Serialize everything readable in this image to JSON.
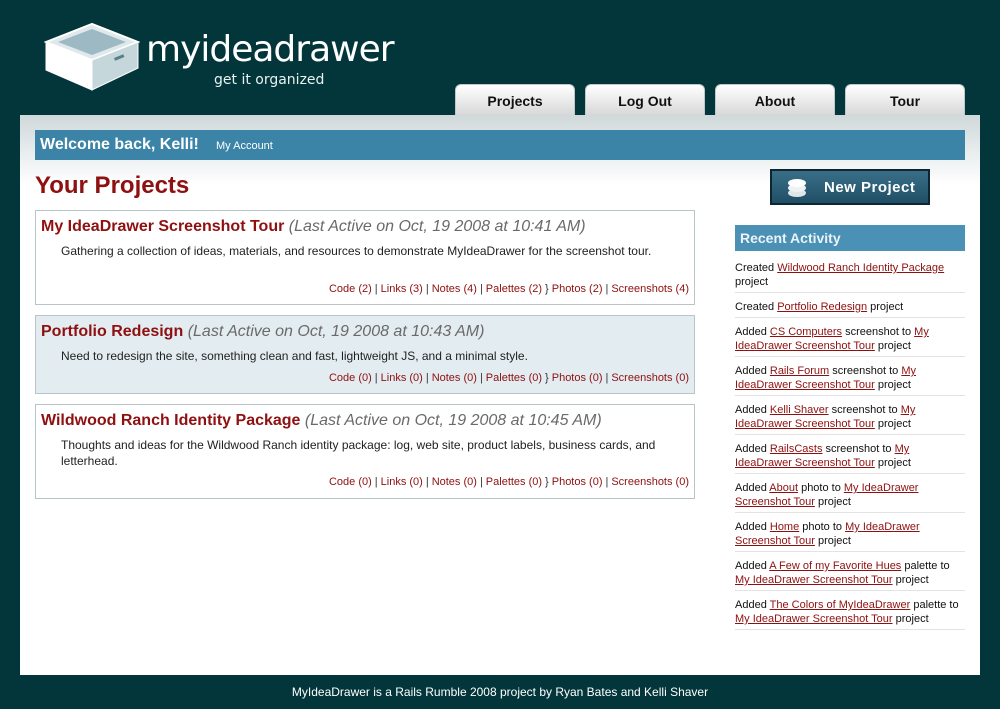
{
  "header": {
    "brand": "myideadrawer",
    "tagline": "get it organized"
  },
  "tabs": [
    {
      "label": "Projects"
    },
    {
      "label": "Log Out"
    },
    {
      "label": "About"
    },
    {
      "label": "Tour"
    }
  ],
  "welcome": {
    "greeting": "Welcome back, Kelli!",
    "account_link": "My Account"
  },
  "page_title": "Your Projects",
  "new_project_button": "New Project",
  "projects": [
    {
      "name": "My IdeaDrawer Screenshot Tour",
      "last_active": "(Last Active on Oct, 19 2008 at 10:41 AM)",
      "description": "Gathering a collection of ideas, materials, and resources to demonstrate MyIdeaDrawer for the screenshot tour.",
      "links": {
        "code": "Code (2)",
        "links": "Links (3)",
        "notes": "Notes (4)",
        "palettes": "Palettes (2)",
        "photos": "Photos (2)",
        "screenshots": "Screenshots (4)"
      }
    },
    {
      "name": "Portfolio Redesign",
      "last_active": "(Last Active on Oct, 19 2008 at 10:43 AM)",
      "description": "Need to redesign the site, something clean and fast, lightweight JS, and a minimal style.",
      "links": {
        "code": "Code (0)",
        "links": "Links (0)",
        "notes": "Notes (0)",
        "palettes": "Palettes (0)",
        "photos": "Photos (0)",
        "screenshots": "Screenshots (0)"
      }
    },
    {
      "name": "Wildwood Ranch Identity Package",
      "last_active": "(Last Active on Oct, 19 2008 at 10:45 AM)",
      "description": "Thoughts and ideas for the Wildwood Ranch identity package: log, web site, product labels, business cards, and letterhead.",
      "links": {
        "code": "Code (0)",
        "links": "Links (0)",
        "notes": "Notes (0)",
        "palettes": "Palettes (0)",
        "photos": "Photos (0)",
        "screenshots": "Screenshots (0)"
      }
    }
  ],
  "recent_activity": {
    "title": "Recent Activity",
    "items": [
      {
        "pre": "Created ",
        "link1": "Wildwood Ranch Identity Package",
        "mid": " project",
        "link2": "",
        "post": ""
      },
      {
        "pre": "Created ",
        "link1": "Portfolio Redesign",
        "mid": " project",
        "link2": "",
        "post": ""
      },
      {
        "pre": "Added ",
        "link1": "CS Computers",
        "mid": " screenshot to ",
        "link2": "My IdeaDrawer Screenshot Tour",
        "post": " project"
      },
      {
        "pre": "Added ",
        "link1": "Rails Forum",
        "mid": " screenshot to ",
        "link2": "My IdeaDrawer Screenshot Tour",
        "post": " project"
      },
      {
        "pre": "Added ",
        "link1": "Kelli Shaver",
        "mid": " screenshot to ",
        "link2": "My IdeaDrawer Screenshot Tour",
        "post": " project"
      },
      {
        "pre": "Added ",
        "link1": "RailsCasts",
        "mid": " screenshot to ",
        "link2": "My IdeaDrawer Screenshot Tour",
        "post": " project"
      },
      {
        "pre": "Added ",
        "link1": "About",
        "mid": " photo to ",
        "link2": "My IdeaDrawer Screenshot Tour",
        "post": " project"
      },
      {
        "pre": "Added ",
        "link1": "Home",
        "mid": " photo to ",
        "link2": "My IdeaDrawer Screenshot Tour",
        "post": " project"
      },
      {
        "pre": "Added ",
        "link1": "A Few of my Favorite Hues",
        "mid": " palette to ",
        "link2": "My IdeaDrawer Screenshot Tour",
        "post": " project"
      },
      {
        "pre": "Added ",
        "link1": "The Colors of MyIdeaDrawer",
        "mid": " palette to ",
        "link2": "My IdeaDrawer Screenshot Tour",
        "post": " project"
      }
    ]
  },
  "footer": "MyIdeaDrawer is a Rails Rumble 2008 project by Ryan Bates and Kelli Shaver",
  "colors": {
    "background": "#02363a",
    "accent_blue": "#3b84a8",
    "title_red": "#8e1010",
    "alt_row": "#e3ecf0"
  }
}
